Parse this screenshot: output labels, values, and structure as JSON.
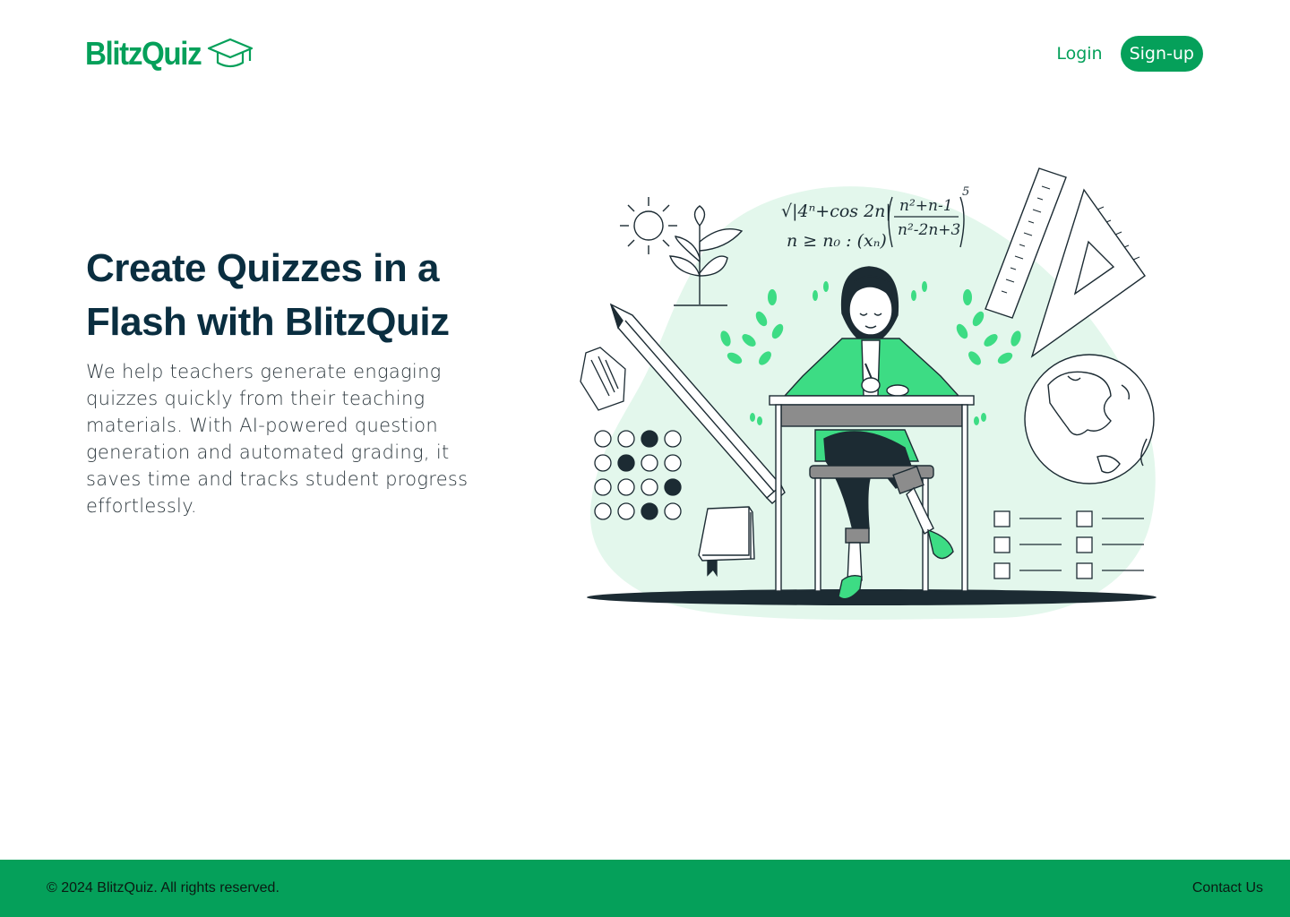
{
  "header": {
    "logo_text": "BlitzQuiz",
    "logo_icon": "graduation-cap-icon",
    "login_label": "Login",
    "signup_label": "Sign-up"
  },
  "hero": {
    "title": "Create Quizzes in a Flash with BlitzQuiz",
    "description": "We help teachers generate engaging quizzes quickly from their teaching materials. With AI-powered question generation and automated grading, it saves time and tracks student progress effortlessly."
  },
  "illustration": {
    "formula_line1": "√|4ⁿ+cos 2n|",
    "formula_line2": "n ≥ n₀ : (xₙ)",
    "fraction_top": "n²+n-1",
    "fraction_bottom": "n²-2n+3",
    "exponent": "5"
  },
  "footer": {
    "copyright": "© 2024 BlitzQuiz. All rights reserved.",
    "contact_label": "Contact Us"
  },
  "colors": {
    "brand": "#05a05a",
    "title": "#0a2e40",
    "blob": "#e3f7ec",
    "accent_green": "#3ddc84",
    "dark": "#1c2b33"
  }
}
